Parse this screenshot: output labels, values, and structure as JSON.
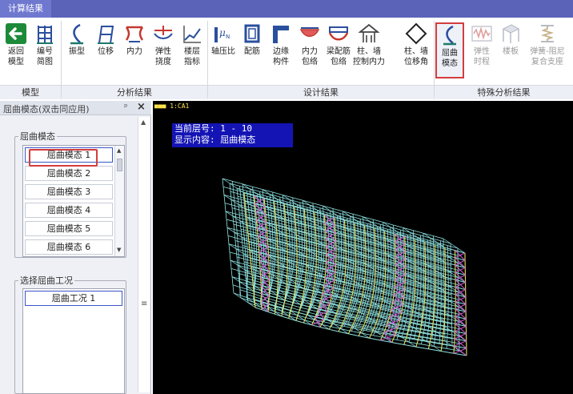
{
  "tabs": {
    "active": "计算结果"
  },
  "ribbon": {
    "buttons": [
      {
        "line1": "返回",
        "line2": "模型"
      },
      {
        "line1": "编号",
        "line2": "简图"
      },
      {
        "line1": "振型",
        "line2": ""
      },
      {
        "line1": "位移",
        "line2": ""
      },
      {
        "line1": "内力",
        "line2": ""
      },
      {
        "line1": "弹性",
        "line2": "挠度"
      },
      {
        "line1": "楼层",
        "line2": "指标"
      },
      {
        "line1": "轴压比",
        "line2": ""
      },
      {
        "line1": "配筋",
        "line2": ""
      },
      {
        "line1": "边缘",
        "line2": "构件"
      },
      {
        "line1": "内力",
        "line2": "包络"
      },
      {
        "line1": "梁配筋",
        "line2": "包络"
      },
      {
        "line1": "柱、墙",
        "line2": "控制内力"
      },
      {
        "line1": "柱、墙",
        "line2": "位移角"
      },
      {
        "line1": "屈曲",
        "line2": "模态"
      },
      {
        "line1": "弹性",
        "line2": "时程"
      },
      {
        "line1": "楼板",
        "line2": ""
      },
      {
        "line1": "弹簧-阻尼",
        "line2": "复合支座"
      }
    ],
    "groups": [
      "模型",
      "分析结果",
      "设计结果",
      "特殊分析结果"
    ]
  },
  "left_panel": {
    "title": "屈曲模态(双击同应用)",
    "pin": "ᵖ",
    "close": "×",
    "mode_group_label": "屈曲模态",
    "modes": [
      "屈曲模态 1",
      "屈曲模态 2",
      "屈曲模态 3",
      "屈曲模态 4",
      "屈曲模态 5",
      "屈曲模态 6"
    ],
    "case_group_label": "选择屈曲工况",
    "cases": [
      "屈曲工况 1"
    ]
  },
  "viewport": {
    "tag": "■■■ 1:CA1",
    "info_line1": "当前层号: 1 - 10",
    "info_line2": "显示内容: 屈曲模态"
  },
  "colors": {
    "tab_bar": "#5a63b8",
    "highlight": "#d33d3d",
    "grid_cyan": "#8fe3e3",
    "grid_yellow": "#e6e05a",
    "grid_magenta": "#d35ad3"
  }
}
